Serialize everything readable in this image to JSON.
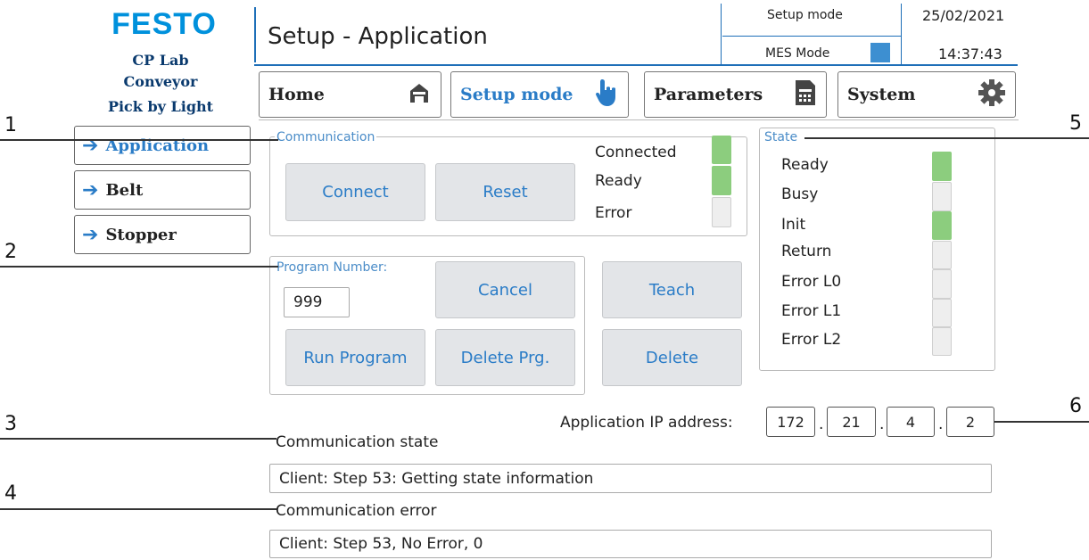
{
  "header": {
    "logo": "FESTO",
    "station_line1": "CP Lab",
    "station_line2": "Conveyor",
    "station_line3": "Pick by Light",
    "title": "Setup - Application",
    "mode": "Setup mode",
    "mes_label": "MES Mode",
    "date": "25/02/2021",
    "time": "14:37:43",
    "mes_color": "#3d8fd1"
  },
  "nav": {
    "home": "Home",
    "setup": "Setup mode",
    "parameters": "Parameters",
    "system": "System"
  },
  "side": {
    "items": [
      {
        "label": "Application",
        "active": true
      },
      {
        "label": "Belt",
        "active": false
      },
      {
        "label": "Stopper",
        "active": false
      }
    ]
  },
  "communication": {
    "title": "Communication",
    "connect": "Connect",
    "reset": "Reset",
    "connected": "Connected",
    "ready": "Ready",
    "error": "Error",
    "lamps": [
      true,
      true,
      false
    ]
  },
  "program": {
    "title": "Program Number:",
    "value": "999",
    "cancel": "Cancel",
    "run": "Run Program",
    "delete_prg": "Delete Prg.",
    "teach": "Teach",
    "delete": "Delete"
  },
  "state": {
    "title": "State",
    "items": [
      {
        "label": "Ready",
        "on": true
      },
      {
        "label": "Busy",
        "on": false
      },
      {
        "label": "Init",
        "on": true
      },
      {
        "label": "Return",
        "on": false
      },
      {
        "label": "Error L0",
        "on": false
      },
      {
        "label": "Error L1",
        "on": false
      },
      {
        "label": "Error L2",
        "on": false
      }
    ]
  },
  "ip": {
    "label": "Application IP address:",
    "octets": [
      "172",
      "21",
      "4",
      "2"
    ],
    "sep": "."
  },
  "comm_state": {
    "label": "Communication state",
    "value": "Client: Step 53: Getting state information"
  },
  "comm_error": {
    "label": "Communication error",
    "value": "Client: Step 53, No Error, 0"
  },
  "callouts": [
    "1",
    "2",
    "3",
    "4",
    "5",
    "6"
  ],
  "colors": {
    "accent": "#2a7cc7",
    "lamp_on": "#8ccd7e",
    "lamp_off": "#eeeeee",
    "logo": "#0091dc"
  }
}
